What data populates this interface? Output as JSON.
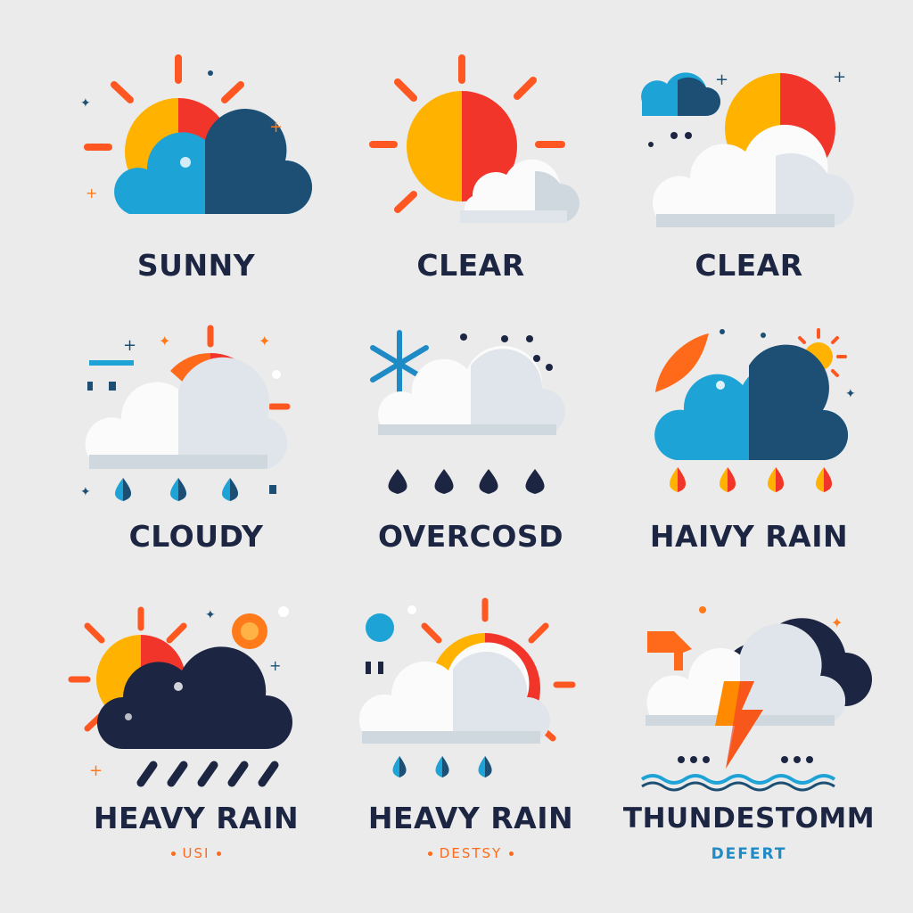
{
  "colors": {
    "background": "#ebebeb",
    "label": "#1c2541",
    "sun_yellow": "#ffb300",
    "sun_orange": "#ff6a1a",
    "sun_red": "#f2352b",
    "cloud_blue": "#1ea3d6",
    "cloud_navy": "#1c4f73",
    "cloud_white": "#fbfbfb",
    "cloud_gray": "#cfd8df",
    "storm_navy": "#1c2541"
  },
  "tiles": [
    {
      "label": "SUNNY",
      "icon": "sun-behind-blue-cloud-icon"
    },
    {
      "label": "CLEAR",
      "icon": "sun-with-small-cloud-icon"
    },
    {
      "label": "CLEAR",
      "icon": "sun-with-clouds-icon"
    },
    {
      "label": "CLOUDY",
      "icon": "cloud-rain-drops-icon"
    },
    {
      "label": "OVERCOSD",
      "icon": "snowflake-cloud-icon"
    },
    {
      "label": "HAIVY RAIN",
      "icon": "cloud-orange-drops-icon"
    },
    {
      "label": "HEAVY RAIN",
      "icon": "dark-cloud-rain-streaks-icon",
      "sub": "USI"
    },
    {
      "label": "HEAVY RAIN",
      "icon": "sun-cloud-rain-icon",
      "sub": "DESTSY"
    },
    {
      "label": "THUNDESTOMM",
      "icon": "thunderstorm-cloud-icon",
      "sub": "DEFERT"
    }
  ]
}
